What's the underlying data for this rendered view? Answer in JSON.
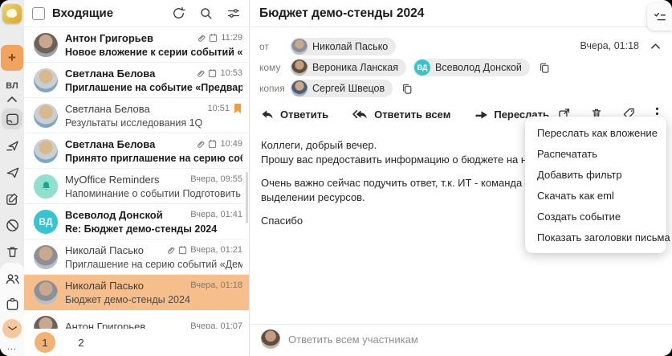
{
  "colors": {
    "accent_orange": "#F2A45F",
    "selected_row_bg": "#F6BE8B",
    "active_page_bg": "#F3B273",
    "flag_orange": "#F59B38",
    "teal_avatar": "#35C4D0",
    "reminder_avatar_bg": "#8FE0CF",
    "reminder_bell": "#18A78E",
    "pill_bg": "#EBEBEB",
    "sidebar_bg": "#ECECEC"
  },
  "sidebar": {
    "compose_label": "+",
    "user_initials": "ВЛ",
    "more_label": "...",
    "icons": [
      "app-logo",
      "collapse-up-icon",
      "inbox-icon",
      "outbox-icon",
      "sent-icon",
      "drafts-icon",
      "spam-icon",
      "trash-icon",
      "contacts-icon",
      "calendar-app-icon",
      "mail-app-icon",
      "more-icon"
    ],
    "active_folder": "inbox",
    "active_app": "mail"
  },
  "mail_list": {
    "title": "Входящие",
    "header_icons": [
      "refresh-icon",
      "search-icon",
      "filter-icon"
    ],
    "emails": [
      {
        "sender": "Антон Григорьев",
        "subject": "Новое вложение к серии событий «Аналити...",
        "time": "11:29",
        "unread": true,
        "attachment": true,
        "calendar": true,
        "flagged": false,
        "selected": false
      },
      {
        "sender": "Светлана Белова",
        "subject": "Приглашение на событие «Предварительно...",
        "time": "10:53",
        "unread": true,
        "attachment": true,
        "calendar": true,
        "flagged": false,
        "selected": false
      },
      {
        "sender": "Светлана Белова",
        "subject": "Результаты исследования 1Q",
        "time": "10:51",
        "unread": false,
        "attachment": false,
        "calendar": false,
        "flagged": true,
        "selected": false
      },
      {
        "sender": "Светлана Белова",
        "subject": "Принято приглашение на серию событий «...",
        "time": "10:49",
        "unread": true,
        "attachment": true,
        "calendar": true,
        "flagged": false,
        "selected": false
      },
      {
        "sender": "MyOffice Reminders",
        "subject": "Напоминание о событии Подготовить отчет...",
        "time": "Вчера, 09:55",
        "unread": false,
        "attachment": false,
        "calendar": false,
        "flagged": false,
        "selected": false
      },
      {
        "sender": "Всеволод Донской",
        "subject": "Re: Бюджет демо-стенды 2024",
        "time": "Вчера, 01:41",
        "unread": true,
        "attachment": false,
        "calendar": false,
        "flagged": false,
        "selected": false,
        "avatar_initials": "ВД"
      },
      {
        "sender": "Николай Пасько",
        "subject": "Приглашение на серию событий «Демо стен...",
        "time": "Вчера, 01:21",
        "unread": false,
        "attachment": true,
        "calendar": true,
        "flagged": false,
        "selected": false
      },
      {
        "sender": "Николай Пасько",
        "subject": "Бюджет демо-стенды 2024",
        "time": "Вчера, 01:18",
        "unread": false,
        "attachment": false,
        "calendar": false,
        "flagged": false,
        "selected": true
      },
      {
        "sender": "Антон Григорьев",
        "subject": "",
        "time": "Вчера, 01:07",
        "unread": false,
        "attachment": false,
        "calendar": false,
        "flagged": false,
        "selected": false
      }
    ],
    "pagination": {
      "pages": [
        "1",
        "2"
      ],
      "active": "1"
    }
  },
  "reading_pane": {
    "subject": "Бюджет демо-стенды 2024",
    "date": "Вчера, 01:18",
    "from_label": "от",
    "from": {
      "name": "Николай Пасько"
    },
    "to_label": "кому",
    "to": [
      {
        "name": "Вероника Ланская"
      },
      {
        "name": "Всеволод Донской",
        "avatar_initials": "ВД"
      }
    ],
    "cc_label": "копия",
    "cc": [
      {
        "name": "Сергей Швецов"
      }
    ],
    "toolbar": {
      "reply": "Ответить",
      "reply_all": "Ответить всем",
      "forward": "Переслать",
      "right_icons": [
        "open-in-new-icon",
        "trash-icon",
        "tag-icon",
        "kebab-menu-icon"
      ]
    },
    "body": {
      "line1": "Коллеги, добрый вечер.",
      "line2": "Прошу вас предоставить информацию о бюджете на наши демонстраци",
      "line3": "Очень важно сейчас подучить ответ, т.к. ИТ - команда Всеволода, уже",
      "line4": "выделении ресурсов.",
      "line5": "Спасибо"
    },
    "quick_reply_placeholder": "Ответить всем участникам",
    "tasks_tab_icon": "checklist-icon"
  },
  "context_menu": {
    "items": [
      "Переслать как вложение",
      "Распечатать",
      "Добавить фильтр",
      "Скачать как eml",
      "Создать событие",
      "Показать заголовки письма"
    ]
  }
}
